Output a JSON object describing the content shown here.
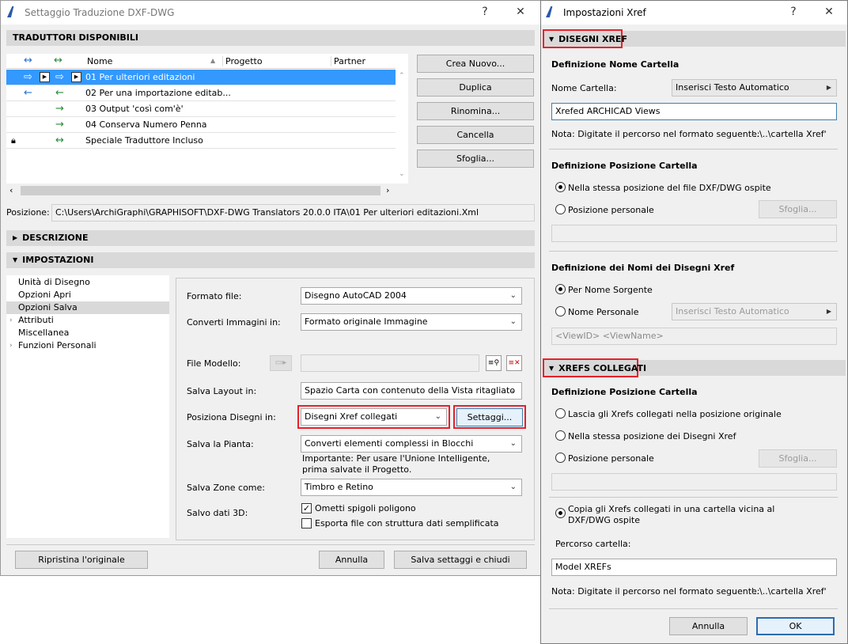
{
  "left_window": {
    "title": "Settaggio Traduzione DXF-DWG",
    "help": "?",
    "close": "✕",
    "sec_translators": "TRADUTTORI DISPONIBILI",
    "columns": {
      "name": "Nome",
      "project": "Progetto",
      "partner": "Partner"
    },
    "translators": [
      {
        "name": "01 Per ulteriori editazioni"
      },
      {
        "name": "02 Per una importazione editab..."
      },
      {
        "name": "03 Output 'così com'è'"
      },
      {
        "name": "04 Conserva Numero Penna"
      },
      {
        "name": "Speciale Traduttore Incluso"
      }
    ],
    "buttons": {
      "new": "Crea Nuovo...",
      "duplicate": "Duplica",
      "rename": "Rinomina...",
      "delete": "Cancella",
      "browse": "Sfoglia..."
    },
    "position_label": "Posizione:",
    "position_value": "C:\\Users\\ArchiGraphi\\GRAPHISOFT\\DXF-DWG Translators 20.0.0 ITA\\01 Per ulteriori editazioni.Xml",
    "sec_description": "DESCRIZIONE",
    "sec_settings": "IMPOSTAZIONI",
    "settings_tree": [
      "Unità di Disegno",
      "Opzioni Apri",
      "Opzioni Salva",
      "Attributi",
      "Miscellanea",
      "Funzioni Personali"
    ],
    "form": {
      "file_format_label": "Formato file:",
      "file_format_value": "Disegno AutoCAD 2004",
      "convert_images_label": "Converti Immagini in:",
      "convert_images_value": "Formato originale Immagine",
      "template_label": "File Modello:",
      "layout_label": "Salva Layout in:",
      "layout_value": "Spazio Carta con contenuto della Vista ritagliato",
      "place_label": "Posiziona Disegni in:",
      "place_value": "Disegni Xref collegati",
      "settings_btn": "Settaggi...",
      "plan_label": "Salva la Pianta:",
      "plan_value": "Converti elementi complessi in Blocchi",
      "plan_note": "Importante: Per usare l'Unione Intelligente, prima salvate il Progetto.",
      "zones_label": "Salva Zone come:",
      "zones_value": "Timbro e Retino",
      "data3d_label": "Salvo dati 3D:",
      "chk_omit": "Ometti spigoli poligono",
      "chk_export": "Esporta file con struttura dati semplificata"
    },
    "footer": {
      "restore": "Ripristina l'originale",
      "cancel": "Annulla",
      "save": "Salva settaggi e chiudi"
    }
  },
  "right_window": {
    "title": "Impostazioni Xref",
    "help": "?",
    "close": "✕",
    "sec_xref": "DISEGNI XREF",
    "folder_name_head": "Definizione Nome Cartella",
    "folder_name_label": "Nome Cartella:",
    "folder_name_combo": "Inserisci Testo Automatico",
    "folder_name_value": "Xrefed ARCHICAD Views",
    "note1_label": "Nota: Digitate il percorso nel formato seguente:",
    "note1_value": "'..\\..\\cartella Xref'",
    "folder_pos_head": "Definizione Posizione Cartella",
    "pos_same": "Nella stessa posizione del file DXF/DWG ospite",
    "pos_custom": "Posizione personale",
    "browse1": "Sfoglia...",
    "names_head": "Definizione dei Nomi dei Disegni Xref",
    "by_source": "Per Nome Sorgente",
    "custom_name": "Nome Personale",
    "custom_name_combo": "Inserisci Testo Automatico",
    "name_pattern": "<ViewID> <ViewName>",
    "sec_linked": "XREFS COLLEGATI",
    "linked_pos_head": "Definizione Posizione Cartella",
    "linked_leave": "Lascia gli Xrefs collegati nella posizione originale",
    "linked_same": "Nella stessa posizione dei Disegni Xref",
    "linked_custom": "Posizione personale",
    "browse2": "Sfoglia...",
    "copy_opt": "Copia gli Xrefs collegati in una cartella vicina al DXF/DWG ospite",
    "path_label": "Percorso cartella:",
    "path_value": "Model XREFs",
    "note2_label": "Nota: Digitate il percorso nel formato seguente:",
    "note2_value": "'..\\..\\cartella Xref'",
    "cancel": "Annulla",
    "ok": "OK"
  },
  "colors": {
    "accent": "#3399ff",
    "highlight_box": "#e8212a"
  }
}
